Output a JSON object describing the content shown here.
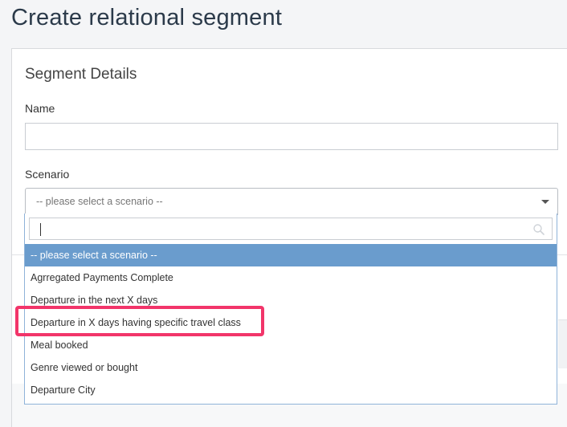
{
  "page": {
    "title": "Create relational segment"
  },
  "segment_details": {
    "title": "Segment Details",
    "name_label": "Name",
    "name_value": "",
    "scenario_label": "Scenario",
    "scenario_selected": "-- please select a scenario --"
  },
  "dropdown": {
    "search_value": "",
    "options": [
      "-- please select a scenario --",
      "Agrregated Payments Complete",
      "Departure in the next X days",
      "Departure in X days having specific travel class",
      "Meal booked",
      "Genre viewed or bought",
      "Departure City"
    ],
    "highlighted_option": "Departure in X days having specific travel class"
  },
  "colors": {
    "selected_option_bg": "#6a9ccd",
    "highlight_outline": "#f2356a"
  },
  "icons": {
    "search": "search-icon",
    "caret": "chevron-down-icon"
  }
}
